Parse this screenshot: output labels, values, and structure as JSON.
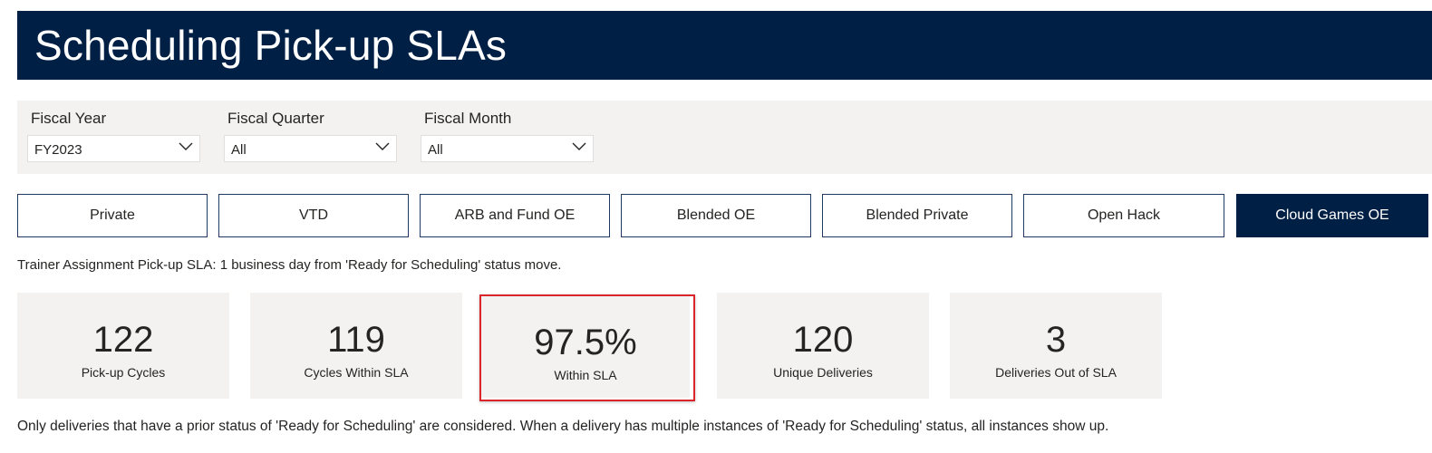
{
  "header": {
    "title": "Scheduling Pick-up SLAs"
  },
  "filters": [
    {
      "label": "Fiscal Year",
      "value": "FY2023"
    },
    {
      "label": "Fiscal Quarter",
      "value": "All"
    },
    {
      "label": "Fiscal Month",
      "value": "All"
    }
  ],
  "tabs": [
    {
      "label": "Private"
    },
    {
      "label": "VTD"
    },
    {
      "label": "ARB and Fund OE"
    },
    {
      "label": "Blended OE"
    },
    {
      "label": "Blended Private"
    },
    {
      "label": "Open Hack"
    },
    {
      "label": "Cloud Games OE",
      "active": true
    }
  ],
  "sla_note": "Trainer Assignment Pick-up SLA: 1 business day from 'Ready for Scheduling' status move.",
  "cards": [
    {
      "value": "122",
      "label": "Pick-up Cycles"
    },
    {
      "value": "119",
      "label": "Cycles Within SLA"
    },
    {
      "value": "97.5%",
      "label": "Within SLA"
    },
    {
      "value": "120",
      "label": "Unique Deliveries"
    },
    {
      "value": "3",
      "label": "Deliveries Out of SLA"
    }
  ],
  "footer_note": "Only deliveries that have a prior status of 'Ready for Scheduling' are considered. When a delivery has multiple instances of 'Ready for Scheduling' status, all instances show up.",
  "colors": {
    "header_bg": "#001f45",
    "panel_bg": "#f3f2f1",
    "highlight_border": "#d9262b"
  }
}
